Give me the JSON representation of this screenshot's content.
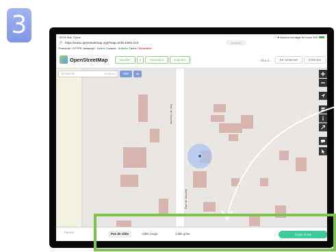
{
  "step_number": "3",
  "status_bar": {
    "time_date": "09:41  Mar. 9 janv.",
    "right": "⌔ ➤ Aucune recharge en cours 100"
  },
  "browser": {
    "url": "https://www.openstreetmap.org/#map=6/46.449/2.210",
    "home_label": "Accéder"
  },
  "proto_bar": {
    "protocol_label": "Protocole : ",
    "protocol_value": "HTTPS",
    "javascript_label": "Javascript : ",
    "javascript_value": "Activé",
    "cookies_label": "Cookies : ",
    "cookies_value": "Activés",
    "cache_label": "Cache : ",
    "cache_value": "Désactivé"
  },
  "osm_header": {
    "brand": "OpenStreetMap",
    "edit_label": "Modifier",
    "edit_dropdown": "▾",
    "history_label": "Historique",
    "export_label": "Exporter",
    "more_label": "Plus ▾",
    "login_label": "Se connecter",
    "signup_label": "S'inscrire"
  },
  "search": {
    "placeholder": "Recherche",
    "hint": "Où est-ce ?",
    "go_label": "Aller",
    "directions_icon": "directions-icon"
  },
  "map": {
    "street_label_1": "Rue de Vaucelle",
    "street_label_2": "Rue de Vaucelle"
  },
  "map_controls": [
    "zoom-in-icon",
    "zoom-out-icon",
    "locate-icon",
    "layers-icon",
    "info-icon",
    "share-icon",
    "note-icon",
    "query-icon"
  ],
  "bottom_bar": {
    "close_label": "Fermer",
    "targets": [
      "Pas de cible",
      "Cible rouge",
      "Cible grise"
    ],
    "copy_label": "Copie écran"
  },
  "colors": {
    "badge": "#8a9ee6",
    "highlight": "#7ec14f",
    "copy_button": "#3fca9a",
    "osm_green": "#7bb963"
  }
}
